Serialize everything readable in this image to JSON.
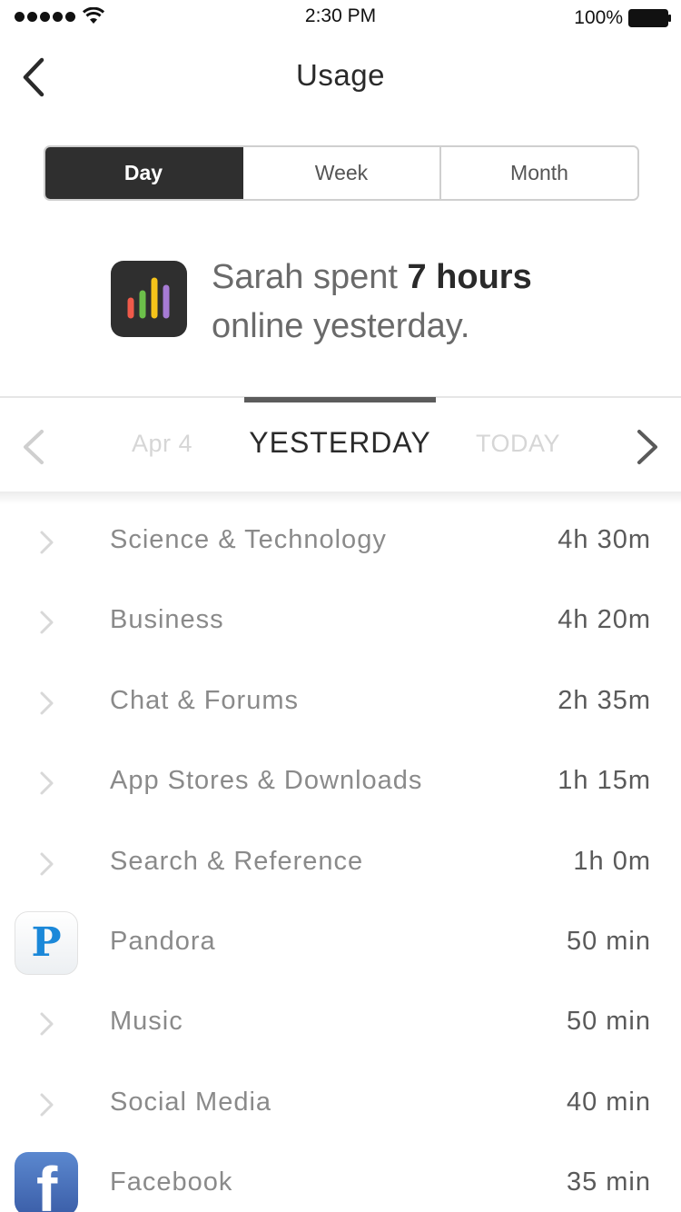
{
  "status_bar": {
    "time": "2:30 PM",
    "battery": "100%",
    "signal_icon": "signal-dots-icon",
    "wifi_icon": "wifi-icon",
    "battery_icon": "battery-icon"
  },
  "nav": {
    "title": "Usage",
    "back_icon": "chevron-left-icon"
  },
  "segments": [
    {
      "label": "Day",
      "selected": true
    },
    {
      "label": "Week",
      "selected": false
    },
    {
      "label": "Month",
      "selected": false
    }
  ],
  "summary": {
    "icon": "bar-chart-icon",
    "prefix": "Sarah spent ",
    "highlight": "7 hours",
    "suffix": "online yesterday."
  },
  "date_switcher": {
    "previous": "Apr 4",
    "current": "YESTERDAY",
    "next": "TODAY"
  },
  "usage_list": [
    {
      "label": "Science & Technology",
      "time": "4h 30m",
      "icon": "chevron-right-icon"
    },
    {
      "label": "Business",
      "time": "4h 20m",
      "icon": "chevron-right-icon"
    },
    {
      "label": "Chat & Forums",
      "time": "2h 35m",
      "icon": "chevron-right-icon"
    },
    {
      "label": "App Stores & Downloads",
      "time": "1h 15m",
      "icon": "chevron-right-icon"
    },
    {
      "label": "Search & Reference",
      "time": "1h 0m",
      "icon": "chevron-right-icon"
    },
    {
      "label": "Pandora",
      "time": "50 min",
      "icon": "pandora-app-icon"
    },
    {
      "label": "Music",
      "time": "50 min",
      "icon": "chevron-right-icon"
    },
    {
      "label": "Social Media",
      "time": "40 min",
      "icon": "chevron-right-icon"
    },
    {
      "label": "Facebook",
      "time": "35 min",
      "icon": "facebook-app-icon"
    }
  ],
  "colors": {
    "dark": "#2f2f2f",
    "bar_red": "#ef5a4a",
    "bar_green": "#6cc04a",
    "bar_yellow": "#f5c31a",
    "bar_purple": "#a67bd4",
    "pandora_blue": "#1b88d9",
    "facebook_blue": "#3b5ea8"
  }
}
